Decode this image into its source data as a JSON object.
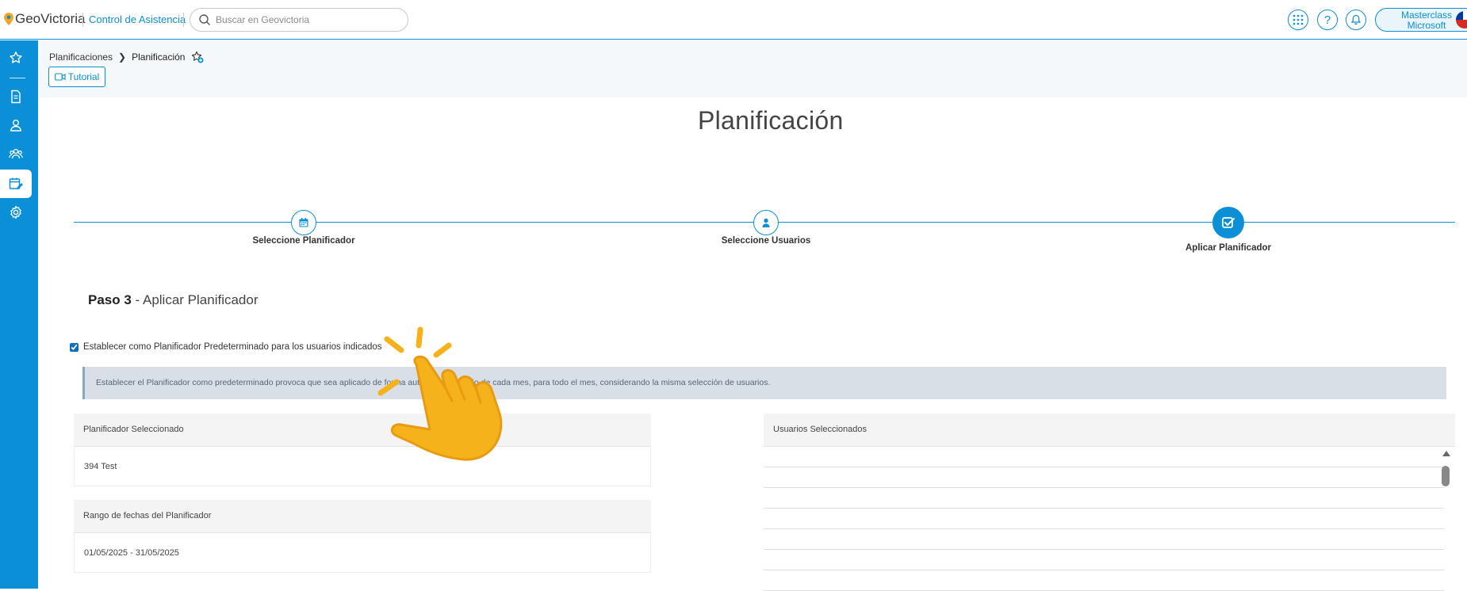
{
  "header": {
    "logo_text": "GeoVictoria",
    "product_name": "Control de Asistencia",
    "search_placeholder": "Buscar en Geovictoria",
    "user_line1": "Masterclass",
    "user_line2": "Microsoft"
  },
  "breadcrumb": {
    "parent": "Planificaciones",
    "current": "Planificación"
  },
  "tutorial_label": "Tutorial",
  "page_title": "Planificación",
  "steps": [
    {
      "label": "Seleccione Planificador",
      "icon": "calendar-icon",
      "active": false
    },
    {
      "label": "Seleccione Usuarios",
      "icon": "user-icon",
      "active": false
    },
    {
      "label": "Aplicar Planificador",
      "icon": "check-square-icon",
      "active": true
    }
  ],
  "step_heading": {
    "bold": "Paso 3",
    "rest": " - Aplicar Planificador"
  },
  "default_checkbox": {
    "label": "Establecer como Planificador Predeterminado para los usuarios indicados",
    "checked": true
  },
  "info_text": "Establecer el Planificador como predeterminado provoca que sea aplicado de forma automática al inicio de cada mes, para todo el mes, considerando la misma selección de usuarios.",
  "selected_planner": {
    "title": "Planificador Seleccionado",
    "value": "394 Test"
  },
  "date_range": {
    "title": "Rango de fechas del Planificador",
    "value": "01/05/2025 - 31/05/2025"
  },
  "selected_users": {
    "title": "Usuarios Seleccionados"
  },
  "colors": {
    "primary": "#0b8fd6",
    "info_bg": "#d9dfe6",
    "hand": "#f6b21a"
  }
}
